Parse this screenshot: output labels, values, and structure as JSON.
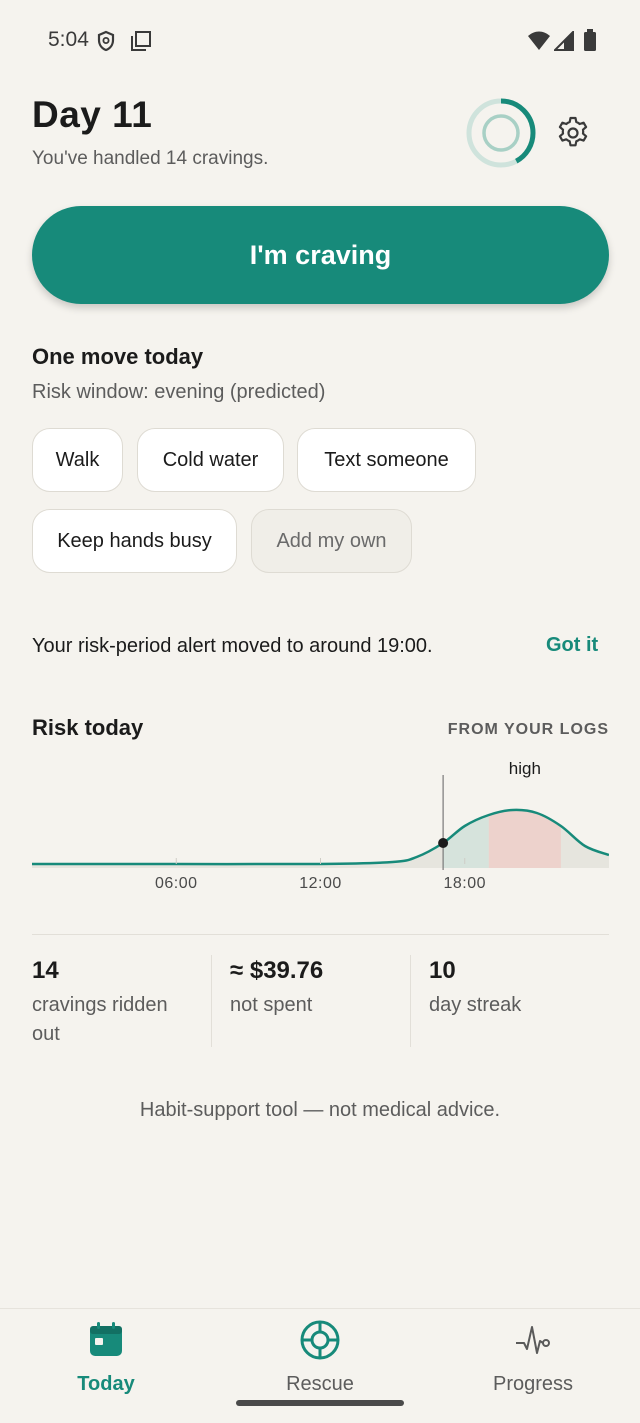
{
  "status_bar": {
    "time": "5:04",
    "icons": [
      "shield-icon",
      "screen-icon",
      "wifi-icon",
      "signal-icon",
      "battery-icon"
    ]
  },
  "header": {
    "title": "Day 11",
    "subtitle": "You've handled 14 cravings.",
    "ring_progress": 0.42,
    "settings_icon": "gear-icon"
  },
  "primary_action": {
    "label": "I'm craving"
  },
  "one_move": {
    "title": "One move today",
    "subtitle": "Risk window: evening (predicted)",
    "chips": [
      "Walk",
      "Cold water",
      "Text someone",
      "Keep hands busy"
    ],
    "add_own": "Add my own"
  },
  "alert": {
    "text": "Your risk-period alert moved to around 19:00.",
    "action": "Got it"
  },
  "risk": {
    "title": "Risk today",
    "source": "FROM YOUR LOGS"
  },
  "chart_data": {
    "type": "area",
    "x_ticks": [
      "06:00",
      "12:00",
      "18:00"
    ],
    "xlim": [
      0,
      24
    ],
    "now": 17.1,
    "x": [
      0,
      6,
      12,
      15,
      16,
      17.1,
      18,
      19,
      20,
      21,
      22,
      23,
      24
    ],
    "y": [
      0.04,
      0.04,
      0.04,
      0.06,
      0.11,
      0.25,
      0.42,
      0.53,
      0.58,
      0.55,
      0.42,
      0.22,
      0.13
    ],
    "high_band": [
      19,
      22
    ],
    "high_label": "high",
    "colors": {
      "line": "#178a7a",
      "past_fill": "#d6e3dc",
      "high_fill": "#edd2cc",
      "base_fill": "#e6e5de"
    }
  },
  "stats": [
    {
      "value": "14",
      "label": "cravings ridden out"
    },
    {
      "value": "≈ $39.76",
      "label": "not spent"
    },
    {
      "value": "10",
      "label": "day streak"
    }
  ],
  "disclaimer": "Habit-support tool — not medical advice.",
  "nav": {
    "items": [
      {
        "label": "Today",
        "icon": "calendar-icon",
        "active": true
      },
      {
        "label": "Rescue",
        "icon": "lifebuoy-icon",
        "active": false
      },
      {
        "label": "Progress",
        "icon": "pulse-icon",
        "active": false
      }
    ]
  },
  "colors": {
    "accent": "#178a7a",
    "background": "#f5f3ee"
  }
}
